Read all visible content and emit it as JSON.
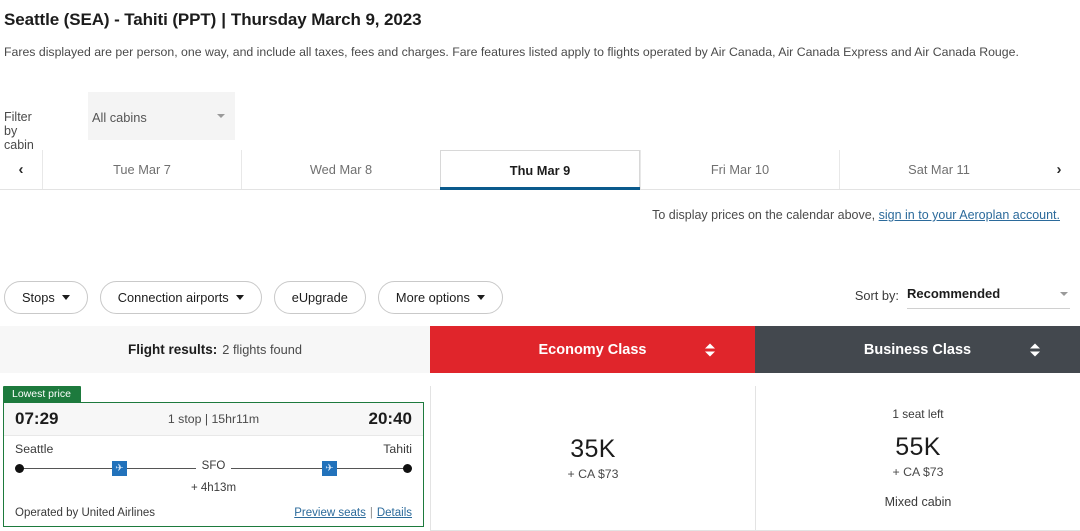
{
  "header": {
    "route_title": "Seattle (SEA) - Tahiti (PPT)",
    "separator": "|",
    "date_title": "Thursday March 9, 2023",
    "disclaimer": "Fares displayed are per person, one way, and include all taxes, fees and charges. Fare features listed apply to flights operated by Air Canada, Air Canada Express and Air Canada Rouge."
  },
  "cabin_filter": {
    "label": "Filter by cabin",
    "selected": "All cabins"
  },
  "date_tabs": {
    "prev_label": "‹",
    "next_label": "›",
    "items": [
      {
        "label": "Tue Mar 7",
        "active": false
      },
      {
        "label": "Wed Mar 8",
        "active": false
      },
      {
        "label": "Thu Mar 9",
        "active": true
      },
      {
        "label": "Fri Mar 10",
        "active": false
      },
      {
        "label": "Sat Mar 11",
        "active": false
      }
    ]
  },
  "signin_note": {
    "text": "To display prices on the calendar above, ",
    "link": "sign in to your Aeroplan account."
  },
  "filters": [
    {
      "label": "Stops",
      "has_caret": true
    },
    {
      "label": "Connection airports",
      "has_caret": true
    },
    {
      "label": "eUpgrade",
      "has_caret": false
    },
    {
      "label": "More options",
      "has_caret": true
    }
  ],
  "sort": {
    "label": "Sort by:",
    "selected": "Recommended"
  },
  "results_header": {
    "results_label": "Flight results:",
    "results_count": "2 flights found",
    "economy_label": "Economy Class",
    "business_label": "Business Class",
    "economy_color": "#e0252b",
    "business_color": "#43484e"
  },
  "flight": {
    "badge": "Lowest price",
    "badge_color": "#1d7a3d",
    "depart_time": "07:29",
    "arrive_time": "20:40",
    "stops_duration": "1 stop | 15hr11m",
    "origin_city": "Seattle",
    "destination_city": "Tahiti",
    "connection_airport": "SFO",
    "layover": "+ 4h13m",
    "operated_by": "Operated by United Airlines",
    "preview_seats_link": "Preview seats",
    "link_separator": "|",
    "details_link": "Details",
    "economy": {
      "points": "35K",
      "cash": "+ CA $73"
    },
    "business": {
      "seats_left": "1 seat left",
      "points": "55K",
      "cash": "+ CA $73",
      "note": "Mixed cabin"
    }
  }
}
